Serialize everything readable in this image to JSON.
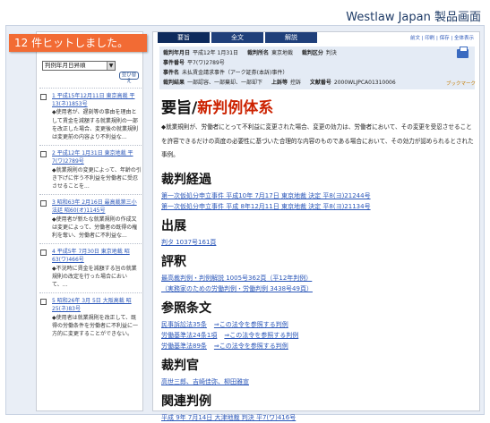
{
  "caption": "Westlaw Japan 製品画面",
  "hits_badge": "12 件ヒットしました。",
  "sort": {
    "selected": "判例年月日昇順",
    "arrow": "▼",
    "button": "並び替え"
  },
  "results": [
    {
      "cite": "1 平成15年12月11日 東京高裁 平13(ネ)1853号",
      "snippet": "◆使用者が、遅刻等の事由を理由として賃金を減額する就業規則の一部を改正した場合、変更後の就業規則は変更前の内容より不利益な..."
    },
    {
      "cite": "2 平成12年 1月31日 東京地裁 平7(ワ)2789号",
      "snippet": "◆就業規則の変更によって、年齢の引き下げに伴う不利益を労働者に受忍させることを..."
    },
    {
      "cite": "3 昭和63年 2月16日 最高裁第三小法廷 昭60(オ)1145号",
      "snippet": "◆使用者が新たな就業規則の作成又は変更によって、労働者の既得の権利を奪い、労働者に不利益な..."
    },
    {
      "cite": "4 平成5年 7月30日 東京地裁 昭63(ワ)466号",
      "snippet": "◆不況時に賃金を減額する旨の就業規則の改定を行った場合において、..."
    },
    {
      "cite": "5 昭和26年 3月 5日 大阪高裁 昭25(ネ)83号",
      "snippet": "◆使用者は就業規則を改正して、既得の労働条件を労働者に不利益に一方的に変更することができない。"
    }
  ],
  "tabs": [
    "要旨",
    "全文",
    "解説"
  ],
  "toplinks": "前文 | 印刷 | 保存 | 全体表示",
  "meta": {
    "row1": [
      {
        "k": "裁判年月日",
        "v": "平成12年 1月31日"
      },
      {
        "k": "裁判所名",
        "v": "東京地裁"
      },
      {
        "k": "裁判区分",
        "v": "判決"
      }
    ],
    "row2": [
      {
        "k": "事件番号",
        "v": "平7(ワ)2789号"
      }
    ],
    "row3": [
      {
        "k": "事件名",
        "v": "未払賃金請求事件（アーク証券(本訴)事件）"
      }
    ],
    "row4": [
      {
        "k": "裁判結果",
        "v": "一部認容、一部棄却、一部却下"
      },
      {
        "k": "上訴等",
        "v": "控訴"
      },
      {
        "k": "文献番号",
        "v": "2000WLJPCA01310006"
      }
    ]
  },
  "bookmark": "ブックマーク",
  "title_prefix": "要旨/",
  "title_red": "新判例体系",
  "summary": "◆就業規則が、労働者にとって不利益に変更された場合、変更の効力は、労働者において、その変更を受忍させることを許容できるだけの高度の必要性に基づいた合理的な内容のものである場合において、その効力が認められるとされた事例。",
  "sections": [
    {
      "heading": "裁判経過",
      "links": [
        "第一次仮処分申立事件 平成10年 7月17日 東京地裁 決定 平8(ヨ)21244号",
        "第一次仮処分申立事件 平成 8年12月11日 東京地裁 決定 平8(ヨ)21134号"
      ]
    },
    {
      "heading": "出展",
      "links": [
        "判タ 1037号161頁"
      ]
    },
    {
      "heading": "評釈",
      "links": [
        "最高裁判例・判例解説 1005号362頁（平12年判例）",
        "（実務家のための労働判例・労働判例 3438号49頁）"
      ]
    },
    {
      "heading": "参照条文",
      "rows": [
        {
          "a": "民事訴訟法35条",
          "b": "⇒この法令を参照する判例"
        },
        {
          "a": "労働基準法24条1項",
          "b": "⇒この法令を参照する判例"
        },
        {
          "a": "労働基準法89条",
          "b": "⇒この法令を参照する判例"
        }
      ]
    },
    {
      "heading": "裁判官",
      "links": [
        "高世三郎、吉崎佳弥、柳田雅宣"
      ]
    },
    {
      "heading": "関連判例",
      "links": [
        "平成 9年 7月14日 大津地裁 判決 平7(ワ)416号"
      ]
    }
  ]
}
